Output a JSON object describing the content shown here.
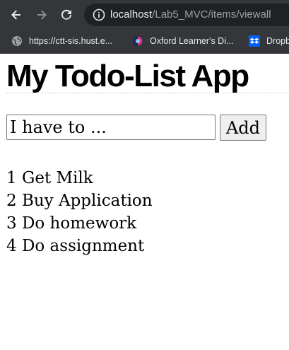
{
  "browser": {
    "url_host": "localhost",
    "url_path": "/Lab5_MVC/items/viewall",
    "colors": {
      "toolbar_bg": "#35363a",
      "omnibox_bg": "#202124",
      "text_light": "#e8eaed"
    },
    "icons": {
      "back": "arrow-left-icon",
      "forward": "arrow-right-icon",
      "reload": "reload-icon",
      "site_info": "info-icon"
    },
    "bookmarks": [
      {
        "label": "https://ctt-sis.hust.e...",
        "icon": "globe-icon"
      },
      {
        "label": "Oxford Learner's Di...",
        "icon": "oxford-icon"
      },
      {
        "label": "Dropb",
        "icon": "dropbox-icon"
      }
    ]
  },
  "page": {
    "title": "My Todo-List App",
    "form": {
      "input_placeholder": "I have to ...",
      "add_label": "Add"
    },
    "todos": [
      {
        "id": "1",
        "text": "Get Milk"
      },
      {
        "id": "2",
        "text": "Buy Application"
      },
      {
        "id": "3",
        "text": "Do homework"
      },
      {
        "id": "4",
        "text": "Do assignment"
      }
    ]
  }
}
